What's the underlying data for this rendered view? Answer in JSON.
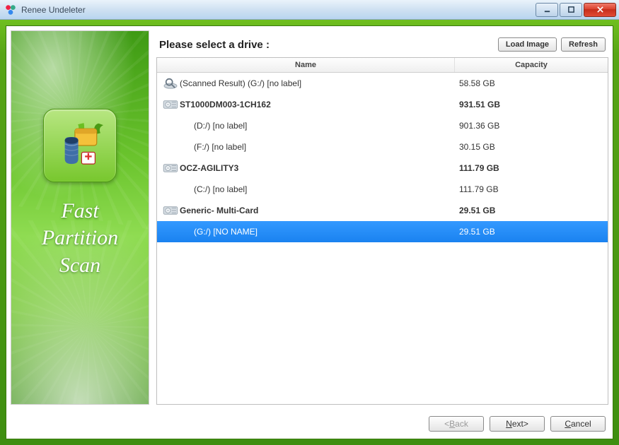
{
  "window": {
    "title": "Renee Undeleter"
  },
  "sidebar": {
    "title": "Fast\nPartition\nScan"
  },
  "main": {
    "instruction": "Please select a drive :",
    "load_image_label": "Load Image",
    "refresh_label": "Refresh",
    "columns": {
      "name": "Name",
      "capacity": "Capacity"
    },
    "rows": [
      {
        "type": "result",
        "icon": "search-icon",
        "name": "(Scanned Result) (G:/) [no label]",
        "capacity": "58.58 GB",
        "bold": false,
        "selected": false
      },
      {
        "type": "disk",
        "icon": "hdd-icon",
        "name": "ST1000DM003-1CH162",
        "capacity": "931.51 GB",
        "bold": true,
        "selected": false
      },
      {
        "type": "partition",
        "icon": "",
        "name": "(D:/) [no label]",
        "capacity": "901.36 GB",
        "bold": false,
        "selected": false
      },
      {
        "type": "partition",
        "icon": "",
        "name": "(F:/) [no label]",
        "capacity": "30.15 GB",
        "bold": false,
        "selected": false
      },
      {
        "type": "disk",
        "icon": "hdd-icon",
        "name": "OCZ-AGILITY3",
        "capacity": "111.79 GB",
        "bold": true,
        "selected": false
      },
      {
        "type": "partition",
        "icon": "",
        "name": "(C:/) [no label]",
        "capacity": "111.79 GB",
        "bold": false,
        "selected": false
      },
      {
        "type": "disk",
        "icon": "hdd-icon",
        "name": "Generic- Multi-Card",
        "capacity": "29.51 GB",
        "bold": true,
        "selected": false
      },
      {
        "type": "partition",
        "icon": "",
        "name": "(G:/) [NO NAME]",
        "capacity": "29.51 GB",
        "bold": false,
        "selected": true
      }
    ]
  },
  "footer": {
    "back": {
      "label": "Back",
      "prefix": "<",
      "enabled": false
    },
    "next": {
      "label": "Next",
      "suffix": ">",
      "enabled": true
    },
    "cancel": {
      "label": "Cancel",
      "enabled": true
    }
  }
}
